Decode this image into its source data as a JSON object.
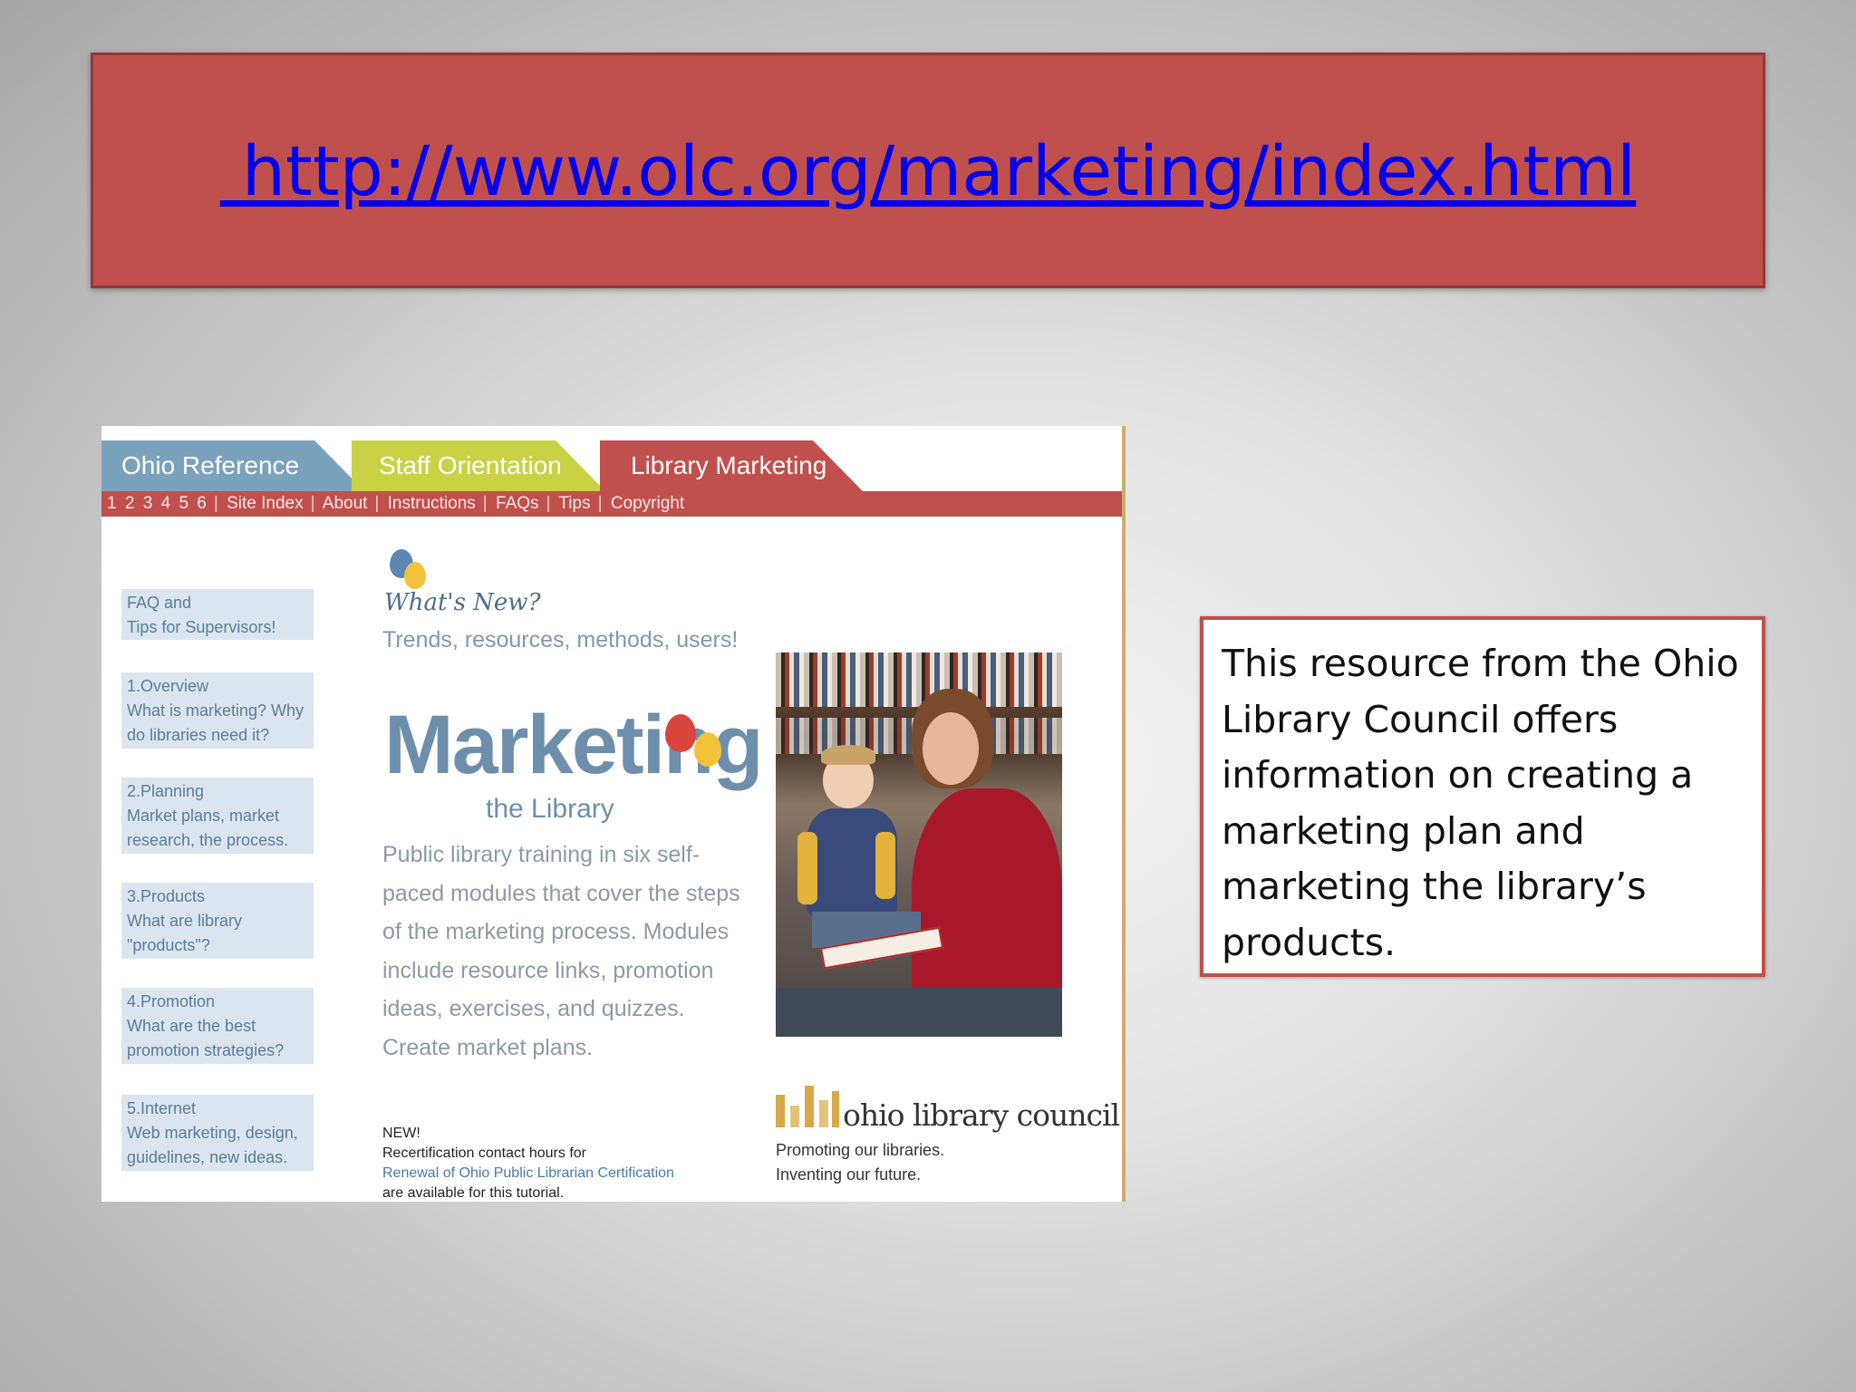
{
  "slide": {
    "title_url": " http://www.olc.org/marketing/index.html",
    "description": "This resource from the Ohio Library Council offers information on creating a marketing plan and marketing the library’s products."
  },
  "website": {
    "tabs": [
      "Ohio Reference",
      "Staff Orientation",
      "Library Marketing"
    ],
    "nav_items": [
      "1",
      "2",
      "3",
      "4",
      "5",
      "6",
      "Site Index",
      "About",
      "Instructions",
      "FAQs",
      "Tips",
      "Copyright"
    ],
    "sidebar": [
      {
        "title": "FAQ and",
        "desc": "Tips for Supervisors!"
      },
      {
        "title": "1.Overview",
        "desc": "What is marketing? Why do libraries need it?"
      },
      {
        "title": "2.Planning",
        "desc": "Market plans, market research, the process."
      },
      {
        "title": "3.Products",
        "desc": "What are library \"products\"?"
      },
      {
        "title": "4.Promotion",
        "desc": "What are the best promotion strategies?"
      },
      {
        "title": "5.Internet",
        "desc": "Web marketing, design, guidelines, new ideas."
      }
    ],
    "whats_new": "What's New?",
    "trends": "Trends, resources, methods, users!",
    "marketing_title": "Marketing",
    "marketing_subtitle": "the Library",
    "blurb": "Public library training in six self-paced modules that cover the steps of the marketing process. Modules include resource links, promotion ideas, exercises, and quizzes. Create market plans.",
    "news_label": "NEW!",
    "news_line1": "Recertification contact hours for",
    "news_link": "Renewal of Ohio Public Librarian Certification",
    "news_line2": "are available for this tutorial.",
    "olc_name": "ohio library council",
    "olc_tagline1": "Promoting our libraries.",
    "olc_tagline2": "Inventing our future."
  },
  "colors": {
    "title_box": "#c0504d",
    "link": "#0000ee",
    "tab_ohio": "#7ba2bd",
    "tab_staff": "#c9d245",
    "tab_library": "#c0504d"
  }
}
